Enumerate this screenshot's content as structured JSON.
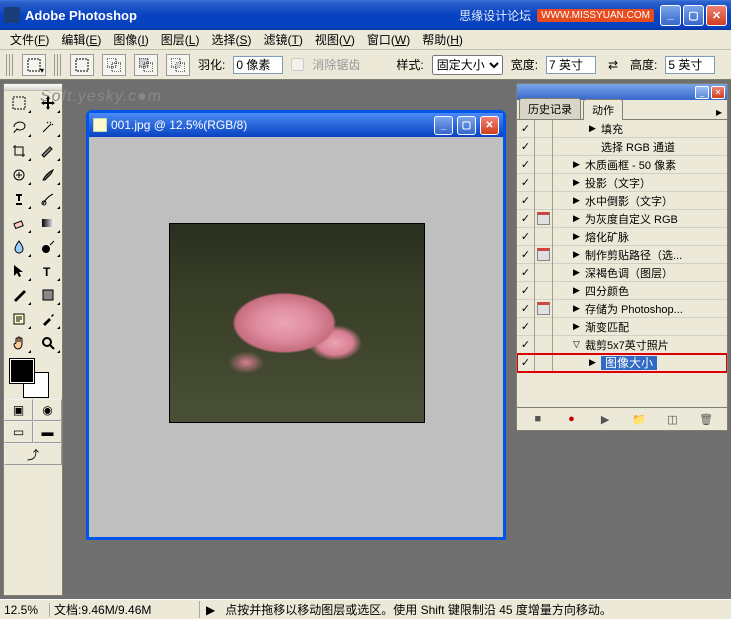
{
  "app": {
    "title": "Adobe Photoshop",
    "forum_text": "思缘设计论坛",
    "badge": "WWW.MISSYUAN.COM"
  },
  "menus": [
    {
      "label": "文件",
      "key": "F"
    },
    {
      "label": "编辑",
      "key": "E"
    },
    {
      "label": "图像",
      "key": "I"
    },
    {
      "label": "图层",
      "key": "L"
    },
    {
      "label": "选择",
      "key": "S"
    },
    {
      "label": "滤镜",
      "key": "T"
    },
    {
      "label": "视图",
      "key": "V"
    },
    {
      "label": "窗口",
      "key": "W"
    },
    {
      "label": "帮助",
      "key": "H"
    }
  ],
  "options": {
    "feather_label": "羽化:",
    "feather_value": "0 像素",
    "antialias_label": "消除锯齿",
    "style_label": "样式:",
    "style_value": "固定大小",
    "width_label": "宽度:",
    "width_value": "7 英寸",
    "height_label": "高度:",
    "height_value": "5 英寸"
  },
  "watermark": "Soft.yesky.c●m",
  "document": {
    "title": "001.jpg @ 12.5%(RGB/8)"
  },
  "panel": {
    "tabs": [
      "历史记录",
      "动作"
    ],
    "active_tab": 1,
    "actions": [
      {
        "checked": true,
        "dialog": false,
        "indent": 2,
        "expand": "▶",
        "label": "填充"
      },
      {
        "checked": true,
        "dialog": false,
        "indent": 2,
        "expand": "",
        "label": "选择 RGB 通道"
      },
      {
        "checked": true,
        "dialog": false,
        "indent": 1,
        "expand": "▶",
        "label": "木质画框 - 50 像素"
      },
      {
        "checked": true,
        "dialog": false,
        "indent": 1,
        "expand": "▶",
        "label": "投影（文字）"
      },
      {
        "checked": true,
        "dialog": false,
        "indent": 1,
        "expand": "▶",
        "label": "水中倒影（文字）"
      },
      {
        "checked": true,
        "dialog": true,
        "indent": 1,
        "expand": "▶",
        "label": "为灰度自定义 RGB"
      },
      {
        "checked": true,
        "dialog": false,
        "indent": 1,
        "expand": "▶",
        "label": "熔化矿脉"
      },
      {
        "checked": true,
        "dialog": true,
        "indent": 1,
        "expand": "▶",
        "label": "制作剪贴路径（选..."
      },
      {
        "checked": true,
        "dialog": false,
        "indent": 1,
        "expand": "▶",
        "label": "深褐色调（图层）"
      },
      {
        "checked": true,
        "dialog": false,
        "indent": 1,
        "expand": "▶",
        "label": "四分颜色"
      },
      {
        "checked": true,
        "dialog": true,
        "indent": 1,
        "expand": "▶",
        "label": "存储为 Photoshop..."
      },
      {
        "checked": true,
        "dialog": false,
        "indent": 1,
        "expand": "▶",
        "label": "渐变匹配"
      },
      {
        "checked": true,
        "dialog": false,
        "indent": 1,
        "expand": "▽",
        "label": "裁剪5x7英寸照片"
      },
      {
        "checked": true,
        "dialog": false,
        "indent": 2,
        "expand": "▶",
        "label": "图像大小",
        "selected": true,
        "highlighted": true
      }
    ]
  },
  "status": {
    "zoom": "12.5%",
    "docinfo": "文档:9.46M/9.46M",
    "hint": "点按并拖移以移动图层或选区。使用 Shift 键限制沿 45 度增量方向移动。"
  },
  "tools": [
    "marquee",
    "move",
    "lasso",
    "wand",
    "crop",
    "slice",
    "healing",
    "brush",
    "stamp",
    "history-brush",
    "eraser",
    "gradient",
    "blur",
    "dodge",
    "path-select",
    "type",
    "pen",
    "shape",
    "notes",
    "eyedropper",
    "hand",
    "zoom"
  ]
}
